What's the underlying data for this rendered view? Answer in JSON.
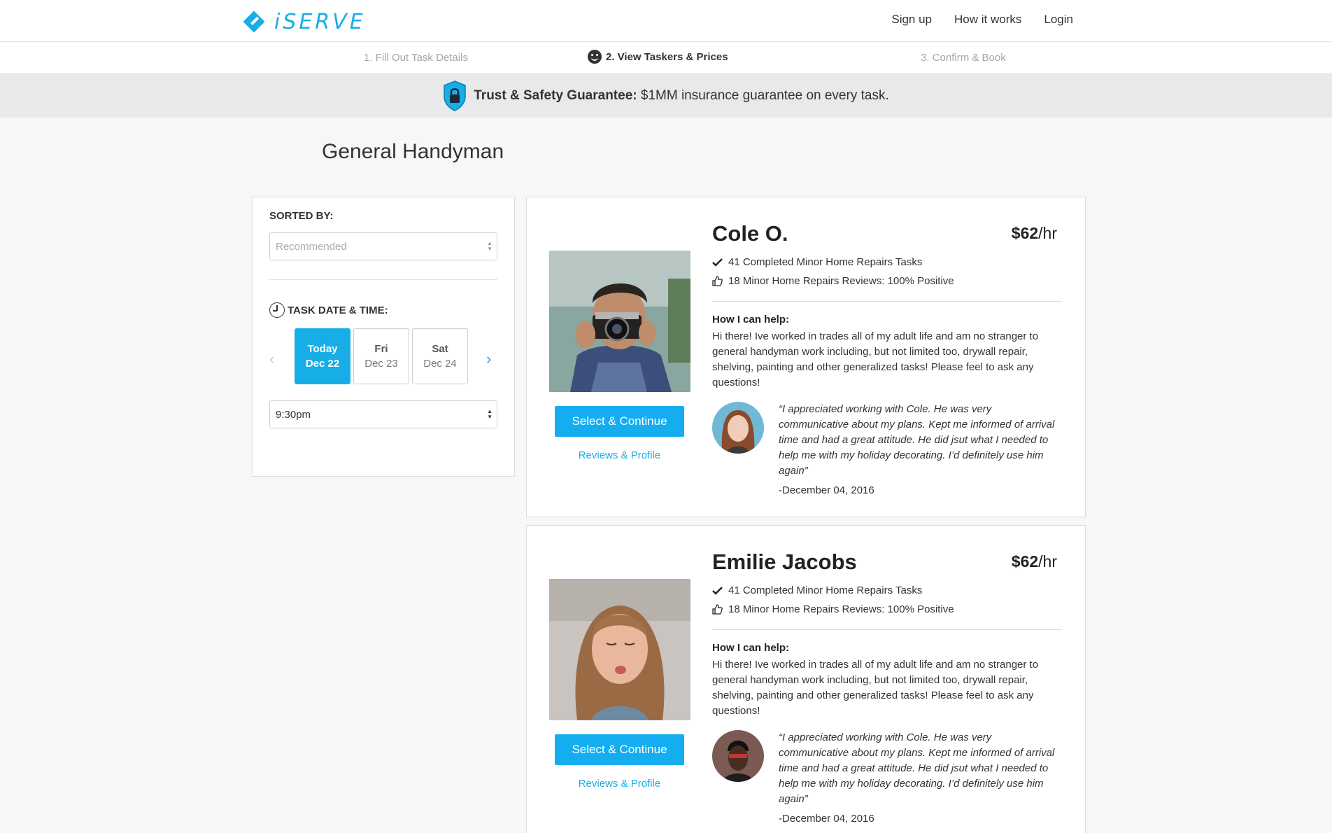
{
  "brand": {
    "name": "iSERVE",
    "accent": "#17aee7"
  },
  "nav": {
    "signup": "Sign up",
    "how": "How it works",
    "login": "Login"
  },
  "steps": [
    "1. Fill Out Task Details",
    "2. View Taskers & Prices",
    "3. Confirm & Book"
  ],
  "banner": {
    "bold": "Trust & Safety Guarantee:",
    "text": " $1MM insurance guarantee on every task."
  },
  "page_title": "General Handyman",
  "sidebar": {
    "sorted_label": "SORTED BY:",
    "sort_value": "Recommended",
    "date_label": "TASK DATE & TIME:",
    "days": [
      {
        "top": "Today",
        "bottom": "Dec 22"
      },
      {
        "top": "Fri",
        "bottom": "Dec 23"
      },
      {
        "top": "Sat",
        "bottom": "Dec 24"
      }
    ],
    "selected_day": 0,
    "time_value": "9:30pm"
  },
  "taskers": [
    {
      "name": "Cole O.",
      "rate": "$62",
      "rate_unit": "/hr",
      "tasks_stat": "41 Completed Minor Home Repairs Tasks",
      "reviews_stat": "18 Minor Home Repairs Reviews: 100% Positive",
      "help_heading": "How I can help:",
      "help_text": "Hi there! Ive worked in trades all of my adult life and am no stranger to general handyman work including, but not limited too, drywall repair, shelving, painting and other generalized tasks! Please feel to ask any questions!",
      "review_quote": "“I appreciated working with Cole. He was very communicative about my plans. Kept me informed of arrival time and had a great attitude. He did jsut what I needed to help me with my holiday decorating. I’d definitely use him again”",
      "review_date": "-December 04, 2016",
      "select_label": "Select & Continue",
      "profile_label": "Reviews & Profile"
    },
    {
      "name": "Emilie Jacobs",
      "rate": "$62",
      "rate_unit": "/hr",
      "tasks_stat": "41 Completed Minor Home Repairs Tasks",
      "reviews_stat": "18 Minor Home Repairs Reviews: 100% Positive",
      "help_heading": "How I can help:",
      "help_text": "Hi there! Ive worked in trades all of my adult life and am no stranger to general handyman work including, but not limited too, drywall repair, shelving, painting and other generalized tasks! Please feel to ask any questions!",
      "review_quote": "“I appreciated working with Cole. He was very communicative about my plans. Kept me informed of arrival time and had a great attitude. He did jsut what I needed to help me with my holiday decorating. I’d definitely use him again”",
      "review_date": "-December 04, 2016",
      "select_label": "Select & Continue",
      "profile_label": "Reviews & Profile"
    }
  ]
}
